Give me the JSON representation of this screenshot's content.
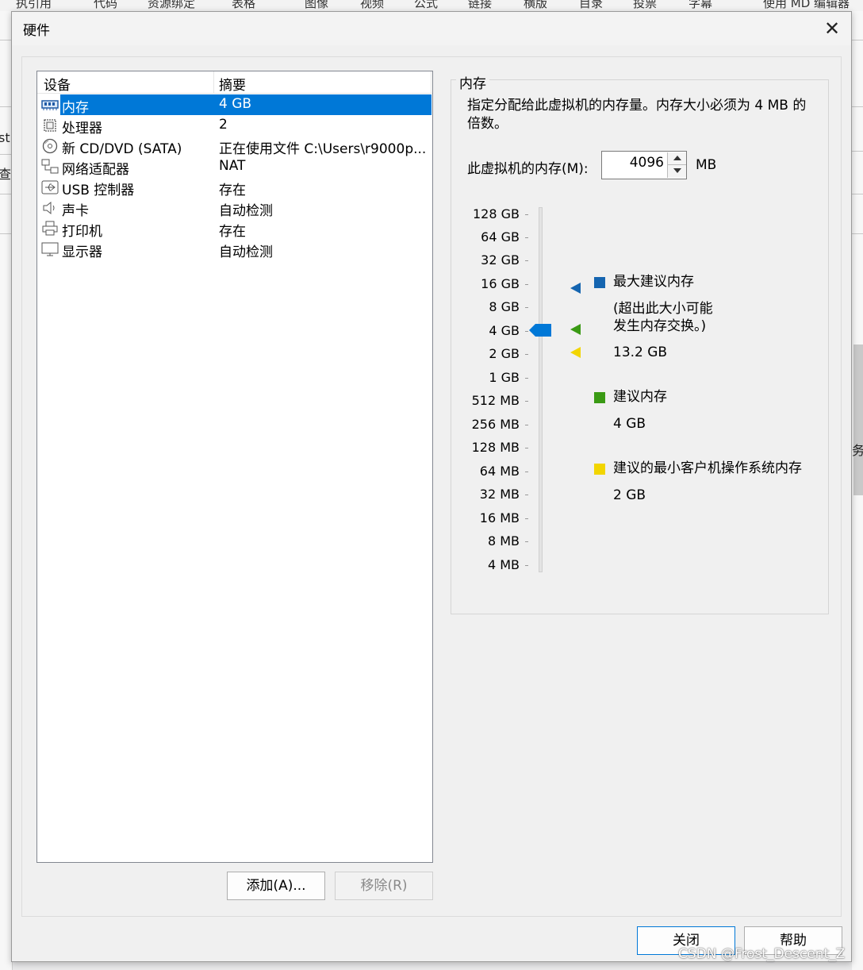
{
  "background": {
    "toolbar_fragments": [
      "执引用",
      "代码",
      "资源绑定",
      "表格",
      "图像",
      "视频",
      "公式",
      "链接",
      "横版",
      "目录",
      "投票",
      "字幕",
      "使用 MD 编辑器"
    ],
    "left_fragments": [
      "st",
      "查"
    ],
    "right_fragment": "务"
  },
  "dialog": {
    "title": "硬件",
    "close_glyph": "✕"
  },
  "device_list": {
    "col_device": "设备",
    "col_summary": "摘要",
    "rows": [
      {
        "name": "内存",
        "summary": "4 GB",
        "icon": "memory-icon"
      },
      {
        "name": "处理器",
        "summary": "2",
        "icon": "processor-icon"
      },
      {
        "name": "新 CD/DVD (SATA)",
        "summary": "正在使用文件 C:\\Users\\r9000p...",
        "icon": "cd-dvd-icon"
      },
      {
        "name": "网络适配器",
        "summary": "NAT",
        "icon": "network-adapter-icon"
      },
      {
        "name": "USB 控制器",
        "summary": "存在",
        "icon": "usb-icon"
      },
      {
        "name": "声卡",
        "summary": "自动检测",
        "icon": "speaker-icon"
      },
      {
        "name": "打印机",
        "summary": "存在",
        "icon": "printer-icon"
      },
      {
        "name": "显示器",
        "summary": "自动检测",
        "icon": "monitor-icon"
      }
    ],
    "selected_index": 0
  },
  "buttons": {
    "add": "添加(A)...",
    "remove": "移除(R)",
    "close": "关闭",
    "help": "帮助"
  },
  "memory": {
    "group_title": "内存",
    "description": "指定分配给此虚拟机的内存量。内存大小必须为 4 MB 的倍数。",
    "input_label": "此虚拟机的内存(M):",
    "value": "4096",
    "unit": "MB",
    "scale": [
      "128 GB",
      "64 GB",
      "32 GB",
      "16 GB",
      "8 GB",
      "4 GB",
      "2 GB",
      "1 GB",
      "512 MB",
      "256 MB",
      "128 MB",
      "64 MB",
      "32 MB",
      "16 MB",
      "8 MB",
      "4 MB"
    ],
    "current_level": "4 GB",
    "legend": {
      "max_title": "最大建议内存",
      "max_note_line1": "(超出此大小可能",
      "max_note_line2": "发生内存交换。)",
      "max_value": "13.2 GB",
      "recommended_title": "建议内存",
      "recommended_value": "4 GB",
      "min_title": "建议的最小客户机操作系统内存",
      "min_value": "2 GB"
    },
    "colors": {
      "max": "#1565b0",
      "recommended": "#3a9a14",
      "min": "#f2d500",
      "thumb": "#0078d7"
    }
  },
  "watermark": "CSDN @Frost_Descent_Z"
}
